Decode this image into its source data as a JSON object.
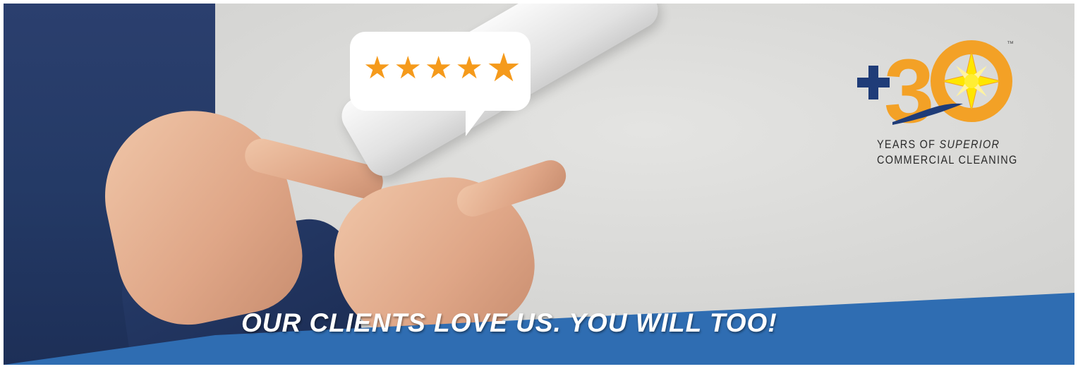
{
  "banner": {
    "tagline": "OUR CLIENTS LOVE US. YOU WILL TOO!",
    "rating": {
      "stars": 5,
      "max": 5
    },
    "colors": {
      "band": "#2f6db2",
      "star": "#f59a1b",
      "navy": "#1f3c78",
      "orange": "#f3a126"
    }
  },
  "logo": {
    "plus": "+",
    "number": "30",
    "trademark": "™",
    "line1_prefix": "YEARS OF ",
    "line1_emphasis": "SUPERIOR",
    "line2": "COMMERCIAL CLEANING"
  },
  "icons": {
    "rating": "star-icon",
    "logo": "compass-star-icon"
  }
}
